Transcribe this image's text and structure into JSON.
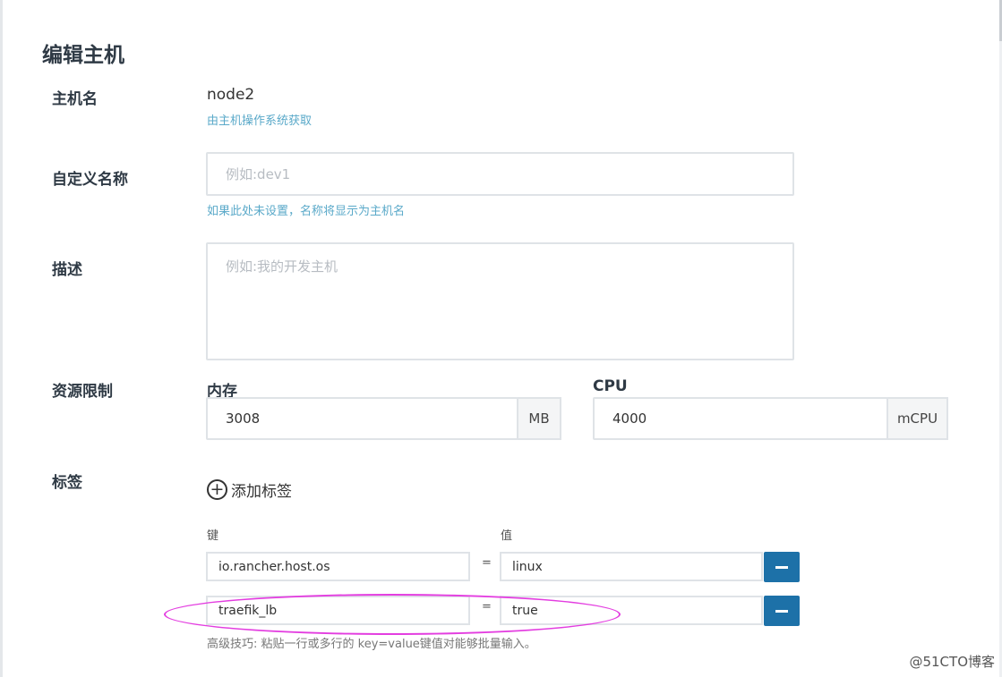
{
  "page": {
    "title": "编辑主机"
  },
  "hostname": {
    "label": "主机名",
    "value": "node2",
    "help": "由主机操作系统获取"
  },
  "custom_name": {
    "label": "自定义名称",
    "placeholder": "例如:dev1",
    "help": "如果此处未设置，名称将显示为主机名"
  },
  "description": {
    "label": "描述",
    "placeholder": "例如:我的开发主机"
  },
  "resources": {
    "label": "资源限制",
    "memory": {
      "label": "内存",
      "value": "3008",
      "unit": "MB"
    },
    "cpu": {
      "label": "CPU",
      "value": "4000",
      "unit": "mCPU"
    }
  },
  "labels": {
    "label": "标签",
    "add_button": "添加标签",
    "key_header": "键",
    "value_header": "值",
    "equals": "=",
    "rows": [
      {
        "key": "io.rancher.host.os",
        "value": "linux"
      },
      {
        "key": "traefik_lb",
        "value": "true"
      }
    ],
    "tip": "高级技巧: 粘贴一行或多行的 key=value键值对能够批量输入。"
  },
  "watermark": "@51CTO博客",
  "colors": {
    "accent": "#1d71a8",
    "help_text": "#5aa9c9",
    "highlight": "#e33de0"
  }
}
